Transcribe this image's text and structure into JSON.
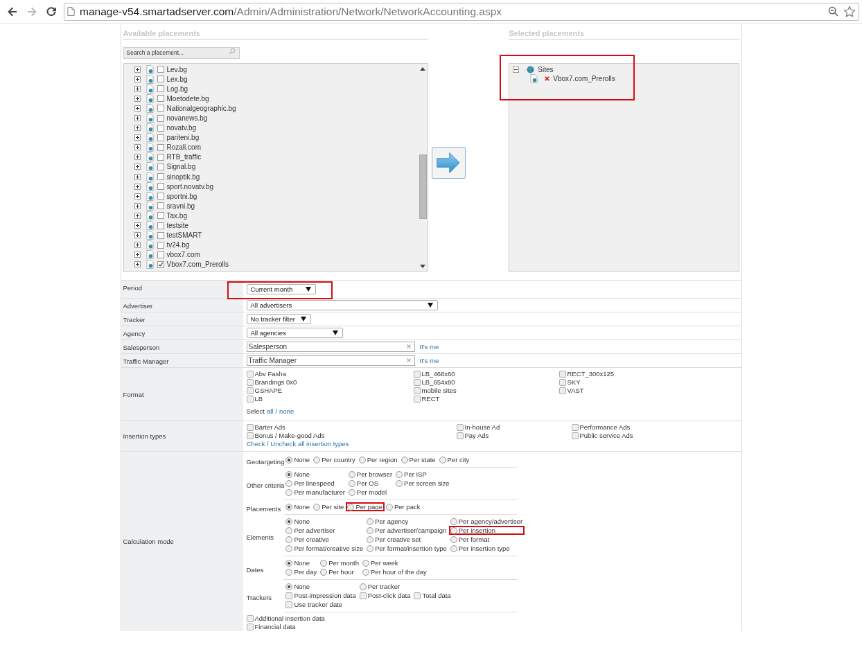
{
  "browser": {
    "nav": [
      {
        "kind": "back",
        "disabled": false
      },
      {
        "kind": "forward",
        "disabled": true
      },
      {
        "kind": "reload",
        "disabled": false
      }
    ],
    "address": {
      "host": "manage-v54.smartadserver.com",
      "path": "/Admin/Administration/Network/NetworkAccounting.aspx"
    }
  },
  "available": {
    "title": "Available placements",
    "search": {
      "placeholder": "Search a placement..."
    },
    "items": [
      {
        "label": "Lev.bg",
        "checked": false
      },
      {
        "label": "Lex.bg",
        "checked": false
      },
      {
        "label": "Log.bg",
        "checked": false
      },
      {
        "label": "Moetodete.bg",
        "checked": false
      },
      {
        "label": "Nationalgeographic.bg",
        "checked": false
      },
      {
        "label": "novanews.bg",
        "checked": false
      },
      {
        "label": "novatv.bg",
        "checked": false
      },
      {
        "label": "pariteni.bg",
        "checked": false
      },
      {
        "label": "Rozali.com",
        "checked": false
      },
      {
        "label": "RTB_traffic",
        "checked": false
      },
      {
        "label": "Signal.bg",
        "checked": false
      },
      {
        "label": "sinoptik.bg",
        "checked": false
      },
      {
        "label": "sport.novatv.bg",
        "checked": false
      },
      {
        "label": "sportni.bg",
        "checked": false
      },
      {
        "label": "sravni.bg",
        "checked": false
      },
      {
        "label": "Tax.bg",
        "checked": false
      },
      {
        "label": "testsite",
        "checked": false
      },
      {
        "label": "testSMART",
        "checked": false
      },
      {
        "label": "tv24.bg",
        "checked": false
      },
      {
        "label": "vbox7.com",
        "checked": false
      },
      {
        "label": "Vbox7.com_Prerolls",
        "checked": true
      }
    ]
  },
  "selected": {
    "title": "Selected placements",
    "highlighted": true,
    "tree": {
      "label": "Sites",
      "expanded": true,
      "children": [
        {
          "label": "Vbox7.com_Prerolls"
        }
      ]
    }
  },
  "filters": [
    {
      "label": "Period",
      "kind": "select",
      "value": "Current month",
      "highlighted": true
    },
    {
      "label": "Advertiser",
      "kind": "select",
      "value": "All advertisers",
      "highlighted": false
    },
    {
      "label": "Tracker",
      "kind": "select",
      "value": "No tracker filter",
      "highlighted": false
    },
    {
      "label": "Agency",
      "kind": "select",
      "value": "All agencies",
      "highlighted": false
    },
    {
      "label": "Salesperson",
      "kind": "picker",
      "placeholder": "Salesperson",
      "link": "It's me",
      "highlighted": false
    },
    {
      "label": "Traffic Manager",
      "kind": "picker",
      "placeholder": "Traffic Manager",
      "link": "It's me",
      "highlighted": false
    }
  ],
  "format": {
    "label": "Format",
    "options": [
      {
        "label": "Abv Fasha",
        "checked": false
      },
      {
        "label": "Brandings 0x0",
        "checked": false
      },
      {
        "label": "GSHAPE",
        "checked": false
      },
      {
        "label": "LB",
        "checked": false
      },
      {
        "label": "LB_468x60",
        "checked": false
      },
      {
        "label": "LB_654x80",
        "checked": false
      },
      {
        "label": "mobile sites",
        "checked": false
      },
      {
        "label": "RECT",
        "checked": false
      },
      {
        "label": "RECT_300x125",
        "checked": false
      },
      {
        "label": "SKY",
        "checked": false
      },
      {
        "label": "VAST",
        "checked": false
      }
    ],
    "select_prefix": "Select",
    "select_all": "all",
    "separator": "/",
    "select_none": "none"
  },
  "insertion_types": {
    "label": "Insertion types",
    "options": [
      {
        "label": "Barter Ads",
        "checked": false
      },
      {
        "label": "Bonus / Make-good Ads",
        "checked": false
      },
      {
        "label": "In-house Ad",
        "checked": false
      },
      {
        "label": "Pay Ads",
        "checked": false
      },
      {
        "label": "Performance Ads",
        "checked": false
      },
      {
        "label": "Public service Ads",
        "checked": false
      }
    ],
    "toggle_link": "Check / Uncheck all insertion types"
  },
  "calculation": {
    "label": "Calculation mode",
    "groups": [
      {
        "label": "Geotargeting",
        "rows": [
          [
            {
              "kind": "radio",
              "label": "None",
              "selected": true,
              "highlighted": false
            },
            {
              "kind": "radio",
              "label": "Per country",
              "selected": false,
              "highlighted": false
            },
            {
              "kind": "radio",
              "label": "Per region",
              "selected": false,
              "highlighted": false
            },
            {
              "kind": "radio",
              "label": "Per state",
              "selected": false,
              "highlighted": false
            },
            {
              "kind": "radio",
              "label": "Per city",
              "selected": false,
              "highlighted": false
            }
          ]
        ]
      },
      {
        "label": "Other criteria",
        "rows": [
          [
            {
              "kind": "radio",
              "label": "None",
              "selected": true,
              "highlighted": false
            },
            {
              "kind": "radio",
              "label": "Per browser",
              "selected": false,
              "highlighted": false
            },
            {
              "kind": "radio",
              "label": "Per ISP",
              "selected": false,
              "highlighted": false
            }
          ],
          [
            {
              "kind": "radio",
              "label": "Per linespeed",
              "selected": false,
              "highlighted": false
            },
            {
              "kind": "radio",
              "label": "Per OS",
              "selected": false,
              "highlighted": false
            },
            {
              "kind": "radio",
              "label": "Per screen size",
              "selected": false,
              "highlighted": false
            }
          ],
          [
            {
              "kind": "radio",
              "label": "Per manufacturer",
              "selected": false,
              "highlighted": false
            },
            {
              "kind": "radio",
              "label": "Per model",
              "selected": false,
              "highlighted": false
            }
          ]
        ]
      },
      {
        "label": "Placements",
        "rows": [
          [
            {
              "kind": "radio",
              "label": "None",
              "selected": true,
              "highlighted": false
            },
            {
              "kind": "radio",
              "label": "Per site",
              "selected": false,
              "highlighted": false
            },
            {
              "kind": "radio",
              "label": "Per page",
              "selected": false,
              "highlighted": true
            },
            {
              "kind": "radio",
              "label": "Per pack",
              "selected": false,
              "highlighted": false
            }
          ]
        ]
      },
      {
        "label": "Elements",
        "rows": [
          [
            {
              "kind": "radio",
              "label": "None",
              "selected": true,
              "highlighted": false
            },
            {
              "kind": "radio",
              "label": "Per agency",
              "selected": false,
              "highlighted": false
            },
            {
              "kind": "radio",
              "label": "Per agency/advertiser",
              "selected": false,
              "highlighted": false
            }
          ],
          [
            {
              "kind": "radio",
              "label": "Per advertiser",
              "selected": false,
              "highlighted": false
            },
            {
              "kind": "radio",
              "label": "Per advertiser/campaign",
              "selected": false,
              "highlighted": false
            },
            {
              "kind": "radio",
              "label": "Per insertion",
              "selected": false,
              "highlighted": true
            }
          ],
          [
            {
              "kind": "radio",
              "label": "Per creative",
              "selected": false,
              "highlighted": false
            },
            {
              "kind": "radio",
              "label": "Per creative set",
              "selected": false,
              "highlighted": false
            },
            {
              "kind": "radio",
              "label": "Per format",
              "selected": false,
              "highlighted": false
            }
          ],
          [
            {
              "kind": "radio",
              "label": "Per format/creative size",
              "selected": false,
              "highlighted": false
            },
            {
              "kind": "radio",
              "label": "Per format/insertion type",
              "selected": false,
              "highlighted": false
            },
            {
              "kind": "radio",
              "label": "Per insertion type",
              "selected": false,
              "highlighted": false
            }
          ]
        ]
      },
      {
        "label": "Dates",
        "rows": [
          [
            {
              "kind": "radio",
              "label": "None",
              "selected": true,
              "highlighted": false
            },
            {
              "kind": "radio",
              "label": "Per month",
              "selected": false,
              "highlighted": false
            },
            {
              "kind": "radio",
              "label": "Per week",
              "selected": false,
              "highlighted": false
            }
          ],
          [
            {
              "kind": "radio",
              "label": "Per day",
              "selected": false,
              "highlighted": false
            },
            {
              "kind": "radio",
              "label": "Per hour",
              "selected": false,
              "highlighted": false
            },
            {
              "kind": "radio",
              "label": "Per hour of the day",
              "selected": false,
              "highlighted": false
            }
          ]
        ]
      },
      {
        "label": "Trackers",
        "rows": [
          [
            {
              "kind": "radio",
              "label": "None",
              "selected": true,
              "highlighted": false
            },
            {
              "kind": "radio",
              "label": "Per tracker",
              "selected": false,
              "highlighted": false
            }
          ],
          [
            {
              "kind": "checkbox",
              "label": "Post-impression data",
              "checked": false,
              "highlighted": false
            },
            {
              "kind": "checkbox",
              "label": "Post-click data",
              "checked": false,
              "highlighted": false
            },
            {
              "kind": "checkbox",
              "label": "Total data",
              "checked": false,
              "highlighted": false
            }
          ],
          [
            {
              "kind": "checkbox",
              "label": "Use tracker date",
              "checked": false,
              "highlighted": false
            }
          ]
        ]
      }
    ],
    "extras": [
      {
        "label": "Additional insertion data",
        "checked": false
      },
      {
        "label": "Financial data",
        "checked": false
      }
    ]
  }
}
